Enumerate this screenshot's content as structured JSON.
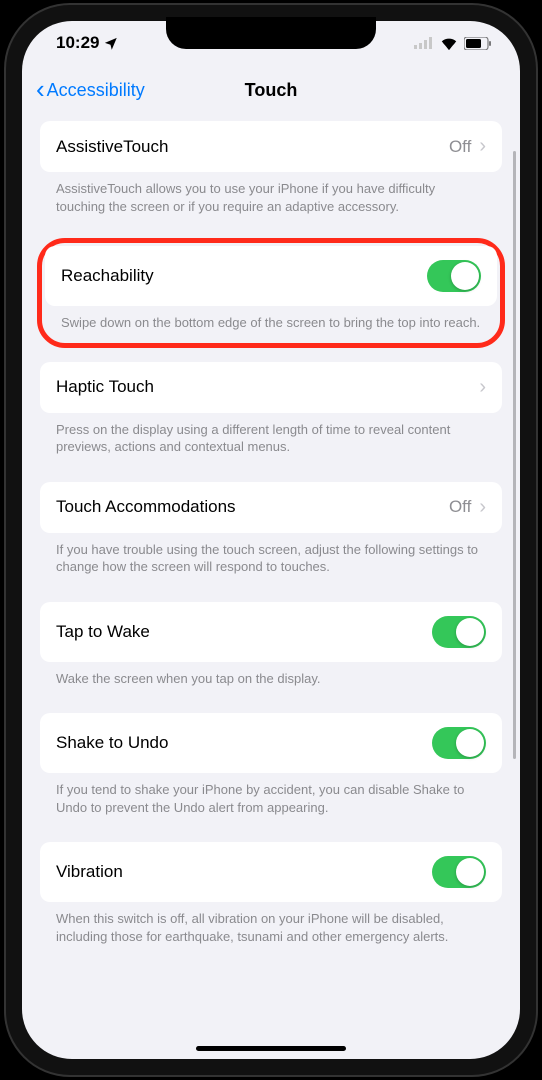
{
  "status": {
    "time": "10:29"
  },
  "nav": {
    "back": "Accessibility",
    "title": "Touch"
  },
  "rows": {
    "assistive": {
      "label": "AssistiveTouch",
      "value": "Off",
      "footer": "AssistiveTouch allows you to use your iPhone if you have difficulty touching the screen or if you require an adaptive accessory."
    },
    "reachability": {
      "label": "Reachability",
      "on": true,
      "footer": "Swipe down on the bottom edge of the screen to bring the top into reach."
    },
    "haptic": {
      "label": "Haptic Touch",
      "footer": "Press on the display using a different length of time to reveal content previews, actions and contextual menus."
    },
    "accommodations": {
      "label": "Touch Accommodations",
      "value": "Off",
      "footer": "If you have trouble using the touch screen, adjust the following settings to change how the screen will respond to touches."
    },
    "tapwake": {
      "label": "Tap to Wake",
      "on": true,
      "footer": "Wake the screen when you tap on the display."
    },
    "shake": {
      "label": "Shake to Undo",
      "on": true,
      "footer": "If you tend to shake your iPhone by accident, you can disable Shake to Undo to prevent the Undo alert from appearing."
    },
    "vibration": {
      "label": "Vibration",
      "on": true,
      "footer": "When this switch is off, all vibration on your iPhone will be disabled, including those for earthquake, tsunami and other emergency alerts."
    }
  }
}
